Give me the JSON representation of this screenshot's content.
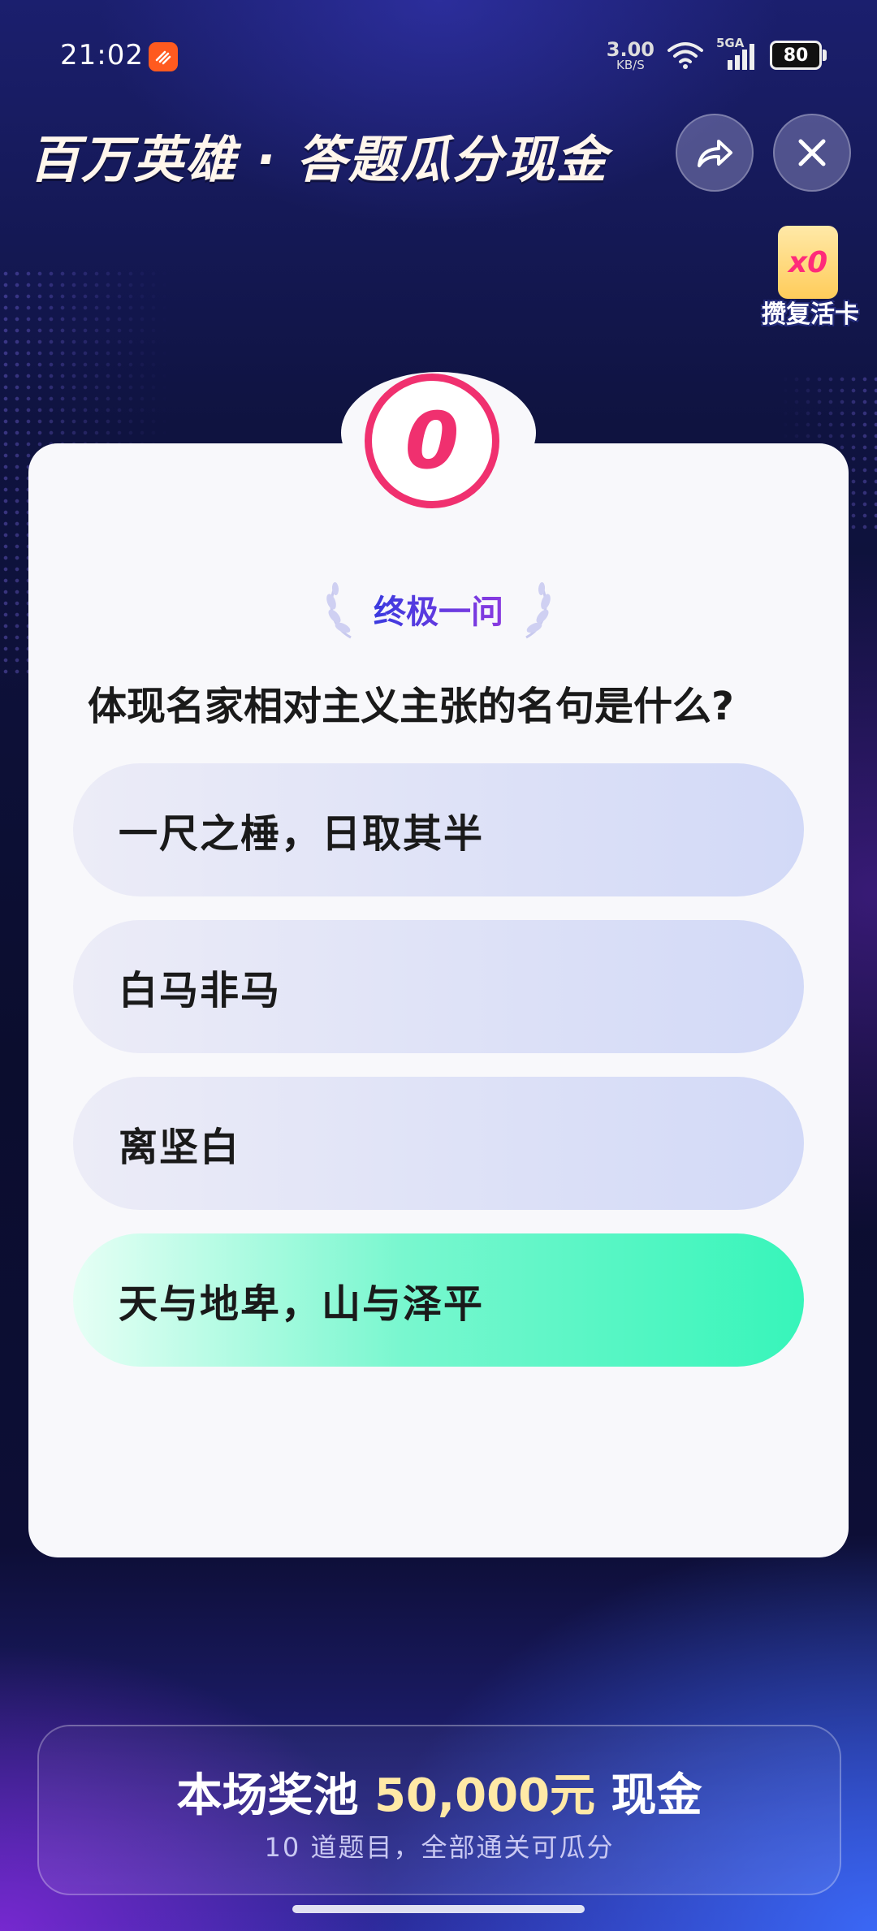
{
  "status_bar": {
    "time": "21:02",
    "net_speed_value": "3.00",
    "net_speed_unit": "KB/S",
    "signal_label": "5GA",
    "battery": "80"
  },
  "header": {
    "title": "百万英雄 · 答题瓜分现金"
  },
  "revive": {
    "count": "x0",
    "label": "攒复活卡"
  },
  "quiz": {
    "timer": "0",
    "round_label": "终极一问",
    "question": "体现名家相对主义主张的名句是什么?",
    "options": [
      {
        "text": "一尺之棰，日取其半",
        "state": "default"
      },
      {
        "text": "白马非马",
        "state": "default"
      },
      {
        "text": "离坚白",
        "state": "default"
      },
      {
        "text": "天与地卑，山与泽平",
        "state": "correct"
      }
    ]
  },
  "prize_pool": {
    "title_prefix": "本场奖池",
    "amount": "50,000元",
    "title_suffix": "现金",
    "subtitle": "10 道题目，全部通关可瓜分"
  },
  "colors": {
    "accent_pink": "#f0306f",
    "correct_green": "#37f5ba",
    "prize_gold": "#ffe9a6"
  }
}
